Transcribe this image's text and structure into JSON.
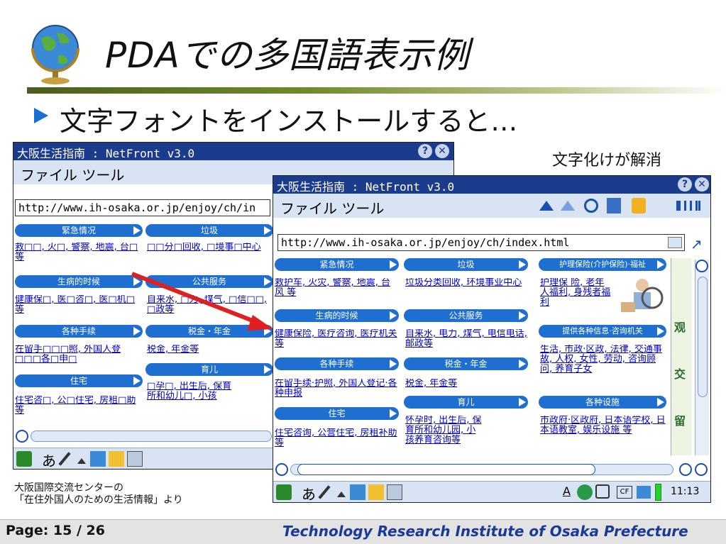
{
  "title": "PDAでの多国語表示例",
  "subtitle": "文字フォントをインストールすると…",
  "fix_label": "文字化けが解消",
  "credit": "大阪国際交流センターの\n「在住外国人のための生活情報」より",
  "footer": {
    "page": "Page: 15 / 26",
    "institute": "Technology Research Institute of Osaka Prefecture"
  },
  "pda_before": {
    "title": "大阪生活指南 : NetFront v3.0",
    "menu": "ファイル  ツール",
    "url": "http://www.ih-osaka.or.jp/enjoy/ch/in",
    "sections": [
      "緊急情况",
      "垃圾",
      "生病的时候",
      "公共服务",
      "各种手续",
      "税金・年金",
      "住宅",
      "育儿"
    ],
    "links": [
      "救□□, 火□, 警察, 地震, 台□ 等",
      "□□分□回收, □境事□中心",
      "健康保□, 医□咨□, 医□机□等",
      "自来水, □力, 煤气, □信□□, □政等",
      "在留手□□□照, 外国人登□□□各□申□",
      "税金, 年金等",
      "住宅咨□, 公□住宅, 房租□助等",
      "□孕□, 出生后, 保育所和幼儿□, 小孩"
    ]
  },
  "pda_after": {
    "title": "大阪生活指南 : NetFront v3.0",
    "menu": "ファイル  ツール",
    "url": "http://www.ih-osaka.or.jp/enjoy/ch/index.html",
    "sections": [
      "紧急情况",
      "垃圾",
      "护理保险(介护保险)·福祉",
      "生病的时候",
      "公共服务",
      "提供各种信息·咨询机关",
      "各种手续",
      "税金・年金",
      "住宅",
      "育儿",
      "各种设施"
    ],
    "links": [
      "救护车, 火灾, 警察, 地震, 台风 等",
      "垃圾分类回收, 环境事业中心",
      "护理保 险, 老年人福利, 身残者福利",
      "健康保险, 医疗咨询, 医疗机关等",
      "自来水, 电力, 煤气, 电信电话, 邮政等",
      "生活, 市政·区政, 法律, 交通事故, 人权, 女性, 劳动, 咨询顾问, 养育子女",
      "在留手续·护照, 外国人登记·各种申报",
      "税金, 年金等",
      "住宅咨询, 公营住宅, 房租补助等",
      "怀孕时, 出生后, 保育所和幼儿园, 小孩养育咨询等",
      "市政府·区政府, 日本语学校, 日本语教室, 娱乐设施 等"
    ],
    "side": [
      "观",
      "交",
      "留"
    ],
    "clock": "11:13",
    "input_mode": "あ"
  },
  "colors": {
    "titlebar": "#1b3b8c",
    "section": "#1f6fd0",
    "link": "#0000cc",
    "institute": "#1a3a9a",
    "arrow": "#e02020"
  }
}
